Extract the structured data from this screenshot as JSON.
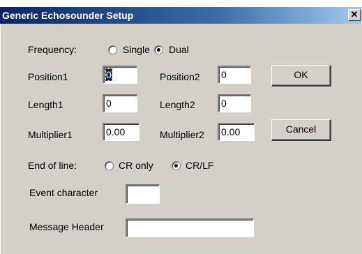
{
  "window": {
    "title": "Generic Echosounder Setup",
    "close_glyph": "✕"
  },
  "frequency": {
    "label": "Frequency:",
    "options": [
      {
        "label": "Single",
        "selected": false
      },
      {
        "label": "Dual",
        "selected": true
      }
    ]
  },
  "fields": {
    "position1": {
      "label": "Position1",
      "value": "0"
    },
    "position2": {
      "label": "Position2",
      "value": "0"
    },
    "length1": {
      "label": "Length1",
      "value": "0"
    },
    "length2": {
      "label": "Length2",
      "value": "0"
    },
    "multiplier1": {
      "label": "Multiplier1",
      "value": "0.00"
    },
    "multiplier2": {
      "label": "Multiplier2",
      "value": "0.00"
    },
    "event_character": {
      "label": "Event character",
      "value": ""
    },
    "message_header": {
      "label": "Message Header",
      "value": ""
    }
  },
  "end_of_line": {
    "label": "End of line:",
    "options": [
      {
        "label": "CR only",
        "selected": false
      },
      {
        "label": "CR/LF",
        "selected": true
      }
    ]
  },
  "buttons": {
    "ok": "OK",
    "cancel": "Cancel"
  }
}
